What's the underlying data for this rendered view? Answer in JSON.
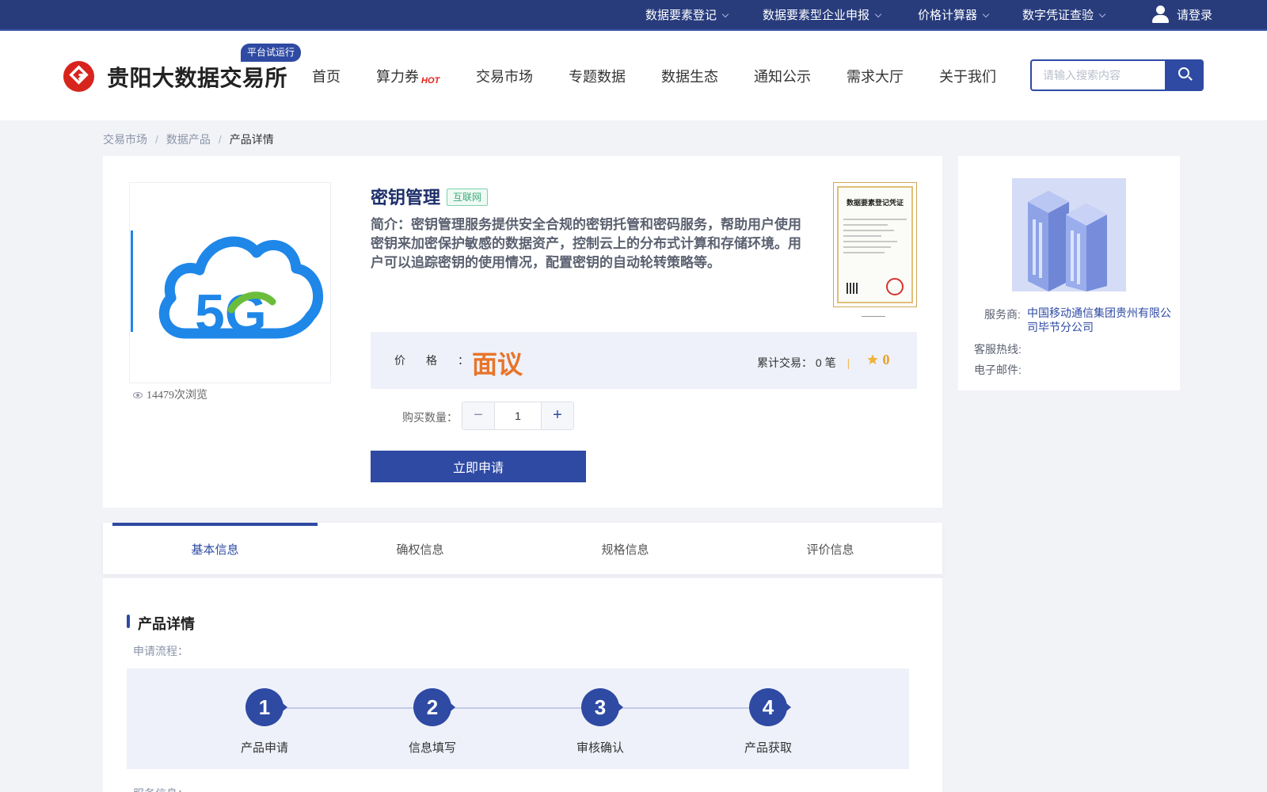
{
  "topbar": {
    "items": [
      "数据要素登记",
      "数据要素型企业申报",
      "价格计算器",
      "数字凭证查验"
    ],
    "login": "请登录"
  },
  "header": {
    "brand": "贵阳大数据交易所",
    "badge": "平台试运行",
    "nav": [
      "首页",
      "算力券",
      "交易市场",
      "专题数据",
      "数据生态",
      "通知公示",
      "需求大厅",
      "关于我们"
    ],
    "hot_badge": "HOT",
    "search_placeholder": "请输入搜索内容",
    "brand_color": "#283c7c",
    "accent_color": "#2e4aa3"
  },
  "breadcrumb": {
    "items": [
      "交易市场",
      "数据产品",
      "产品详情"
    ],
    "separator": "/"
  },
  "product": {
    "views": "14479次浏览",
    "title": "密钥管理",
    "tag": "互联网",
    "intro": "简介：密钥管理服务提供安全合规的密钥托管和密码服务，帮助用户使用密钥来加密保护敏感的数据资产，控制云上的分布式计算和存储环境。用户可以追踪密钥的使用情况，配置密钥的自动轮转策略等。",
    "certificate_title": "数据要素登记凭证",
    "price_label": "价格",
    "price_colon": "：",
    "price_value": "面议",
    "trade_label": "累计交易：",
    "trade_count": "0 笔",
    "trade_divider": "|",
    "rating": "0",
    "qty_label": "购买数量：",
    "qty_value": "1",
    "minus": "−",
    "plus": "+",
    "apply_button": "立即申请"
  },
  "tabs": [
    "基本信息",
    "确权信息",
    "规格信息",
    "评价信息"
  ],
  "details": {
    "section_title": "产品详情",
    "flow_label": "申请流程：",
    "steps": [
      {
        "num": "1",
        "name": "产品申请"
      },
      {
        "num": "2",
        "name": "信息填写"
      },
      {
        "num": "3",
        "name": "审核确认"
      },
      {
        "num": "4",
        "name": "产品获取"
      }
    ],
    "service_label": "服务信息："
  },
  "provider": {
    "service_label": "服务商:",
    "service_value": "中国移动通信集团贵州有限公司毕节分公司",
    "hotline_label": "客服热线:",
    "email_label": "电子邮件:"
  }
}
